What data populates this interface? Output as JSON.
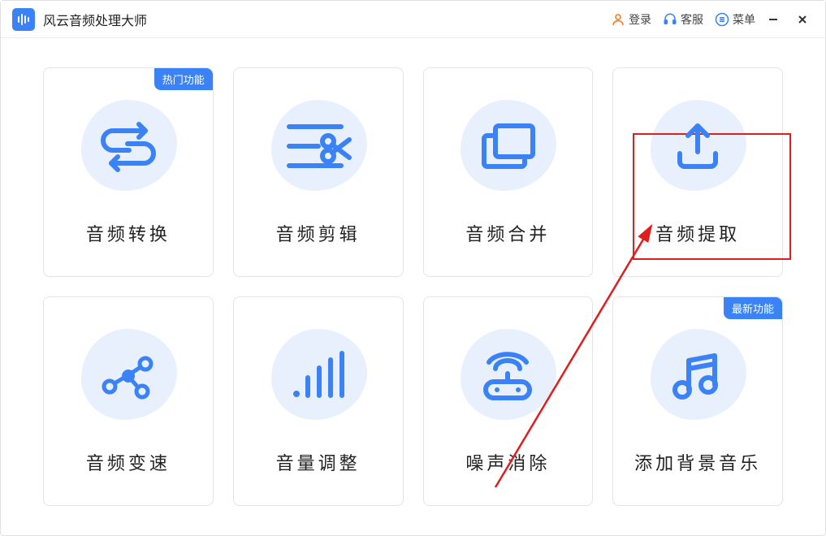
{
  "app": {
    "title": "风云音频处理大师"
  },
  "titlebar": {
    "login": "登录",
    "support": "客服",
    "menu": "菜单"
  },
  "badges": {
    "hot": "热门功能",
    "new": "最新功能"
  },
  "cards": [
    {
      "label": "音频转换",
      "icon": "convert",
      "badge": "hot"
    },
    {
      "label": "音频剪辑",
      "icon": "cut",
      "badge": null
    },
    {
      "label": "音频合并",
      "icon": "merge",
      "badge": null
    },
    {
      "label": "音频提取",
      "icon": "extract",
      "badge": null
    },
    {
      "label": "音频变速",
      "icon": "speed",
      "badge": null
    },
    {
      "label": "音量调整",
      "icon": "volume",
      "badge": null
    },
    {
      "label": "噪声消除",
      "icon": "denoise",
      "badge": null
    },
    {
      "label": "添加背景音乐",
      "icon": "bgm",
      "badge": "new"
    }
  ],
  "annotation": {
    "highlight_card_index": 3,
    "colors": {
      "primary": "#3b82f6",
      "accent": "#e11d1d"
    }
  }
}
